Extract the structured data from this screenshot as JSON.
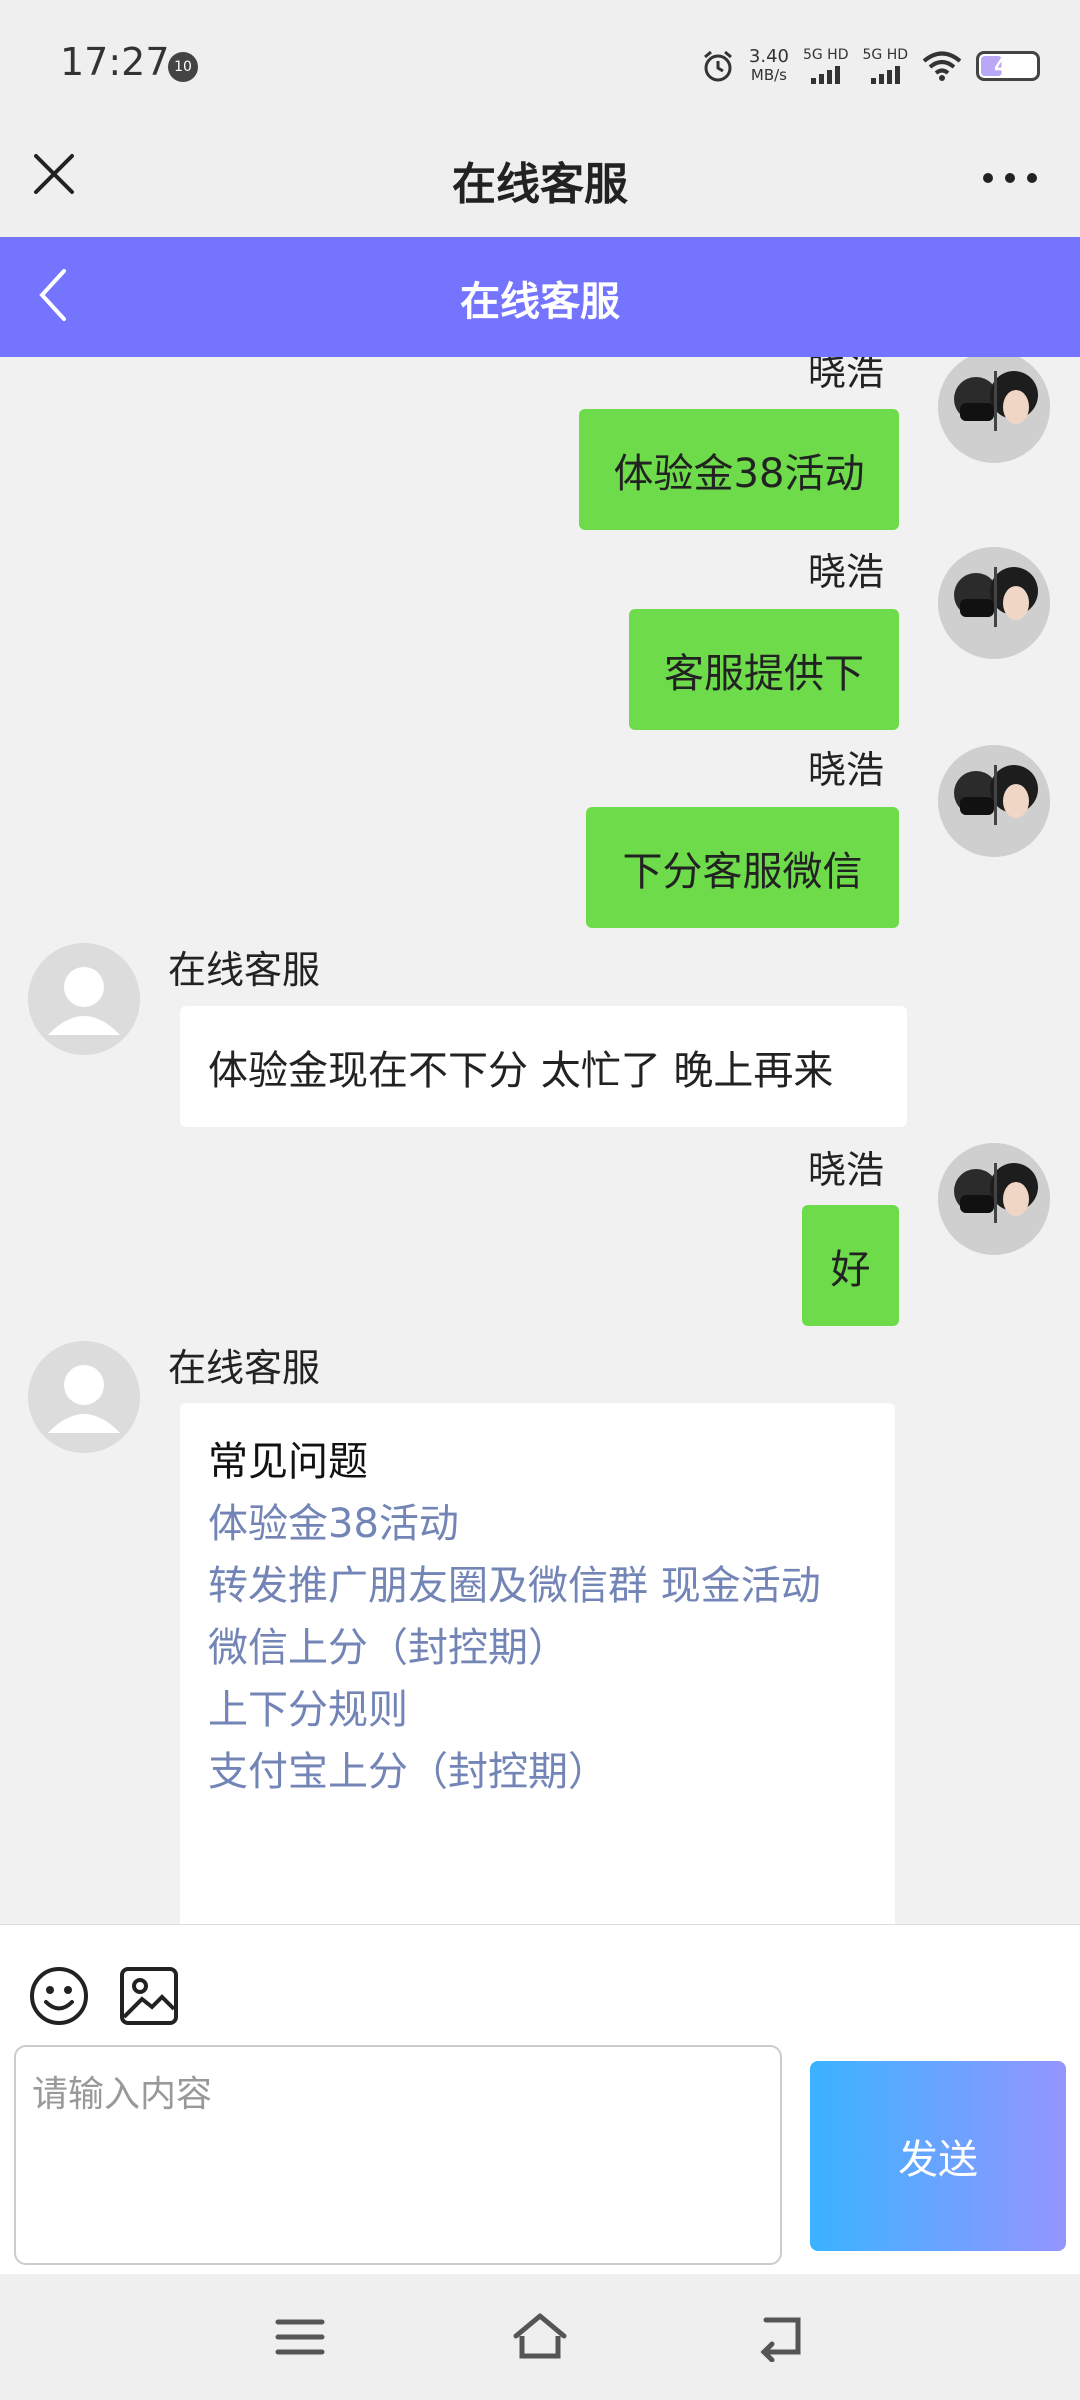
{
  "status_bar": {
    "time": "17:27",
    "notification_count": "10",
    "net_speed_value": "3.40",
    "net_speed_unit": "MB/s",
    "sim1_label": "5G HD",
    "sim2_label": "5G HD",
    "battery_level": "43"
  },
  "titlebar": {
    "title": "在线客服"
  },
  "chat_header": {
    "title": "在线客服"
  },
  "messages": [
    {
      "sender": "晓浩",
      "side": "right",
      "text": "体验金38活动"
    },
    {
      "sender": "晓浩",
      "side": "right",
      "text": "客服提供下"
    },
    {
      "sender": "晓浩",
      "side": "right",
      "text": "下分客服微信"
    },
    {
      "sender": "在线客服",
      "side": "left",
      "text": "体验金现在不下分 太忙了 晚上再来"
    },
    {
      "sender": "晓浩",
      "side": "right",
      "text": "好"
    },
    {
      "sender": "在线客服",
      "side": "left",
      "faq": {
        "title": "常见问题",
        "links": [
          "体验金38活动",
          "转发推广朋友圈及微信群 现金活动",
          "微信上分（封控期）",
          "上下分规则",
          "支付宝上分（封控期）"
        ]
      }
    }
  ],
  "input": {
    "placeholder": "请输入内容",
    "send_label": "发送"
  },
  "colors": {
    "header_purple": "#7474ff",
    "user_bubble_green": "#6edb4b",
    "faq_link_blue": "#7385b6"
  },
  "icons": [
    "close-icon",
    "more-icon",
    "back-icon",
    "emoji-icon",
    "image-icon",
    "menu-icon",
    "home-icon",
    "back-nav-icon"
  ]
}
